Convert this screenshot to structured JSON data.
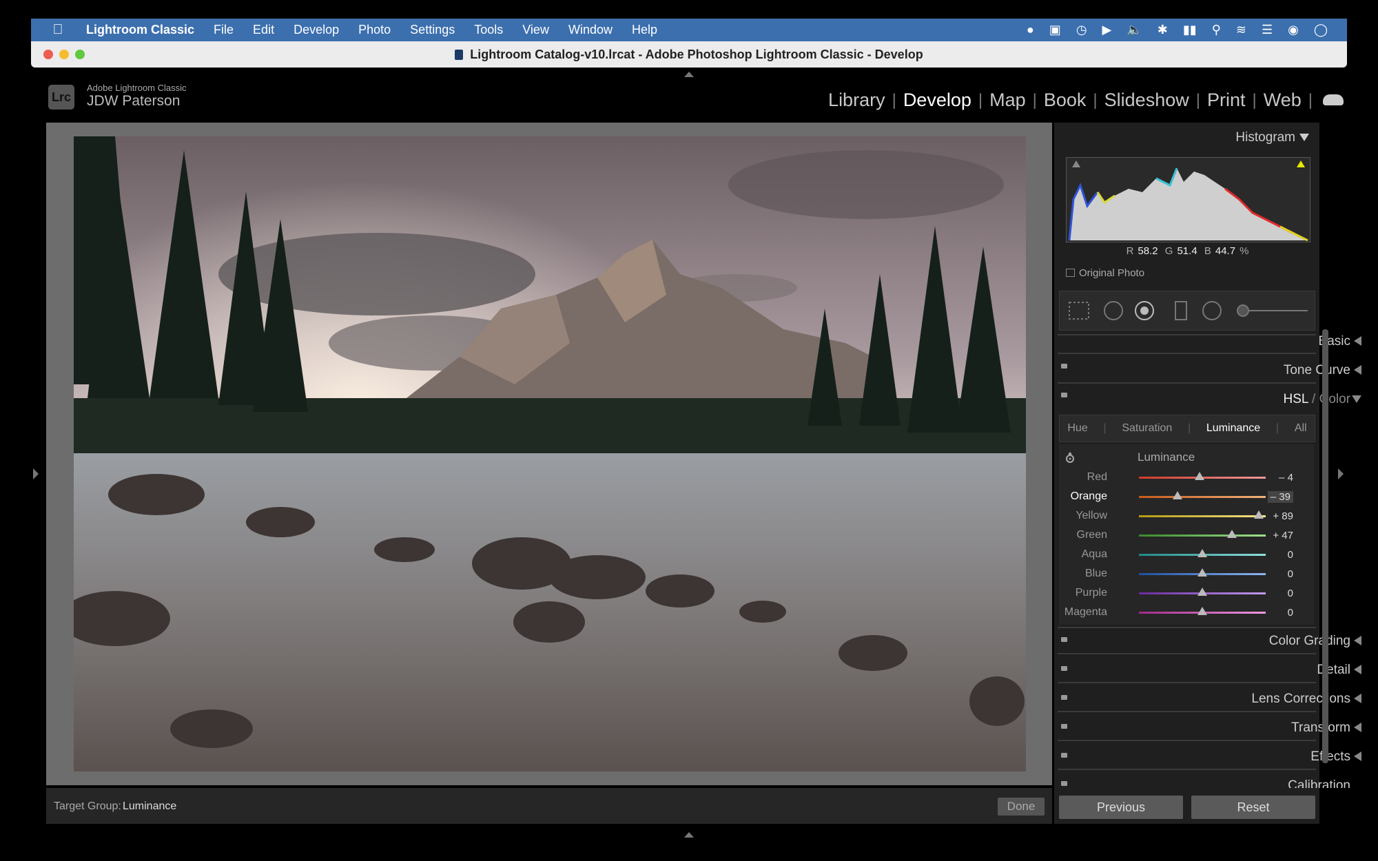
{
  "menubar": {
    "app_name": "Lightroom Classic",
    "items": [
      "File",
      "Edit",
      "Develop",
      "Photo",
      "Settings",
      "Tools",
      "View",
      "Window",
      "Help"
    ]
  },
  "window": {
    "title": "Lightroom Catalog-v10.lrcat - Adobe Photoshop Lightroom Classic - Develop"
  },
  "identity": {
    "logo": "Lrc",
    "brand": "Adobe Lightroom Classic",
    "user": "JDW Paterson"
  },
  "modules": [
    "Library",
    "Develop",
    "Map",
    "Book",
    "Slideshow",
    "Print",
    "Web"
  ],
  "active_module": "Develop",
  "toolbar": {
    "target_group_label": "Target Group:",
    "target_group_value": "Luminance",
    "done_label": "Done"
  },
  "panel": {
    "histogram_title": "Histogram",
    "readout": {
      "r_label": "R",
      "r": "58.2",
      "g_label": "G",
      "g": "51.4",
      "b_label": "B",
      "b": "44.7",
      "unit": "%"
    },
    "original_photo_label": "Original Photo",
    "sections": {
      "basic": "Basic",
      "tone_curve": "Tone Curve",
      "hsl": "HSL",
      "color": "Color",
      "color_sep": " / ",
      "color_grading": "Color Grading",
      "detail": "Detail",
      "lens_corrections": "Lens Corrections",
      "transform": "Transform",
      "effects": "Effects",
      "calibration": "Calibration"
    },
    "hsl_tabs": [
      "Hue",
      "Saturation",
      "Luminance",
      "All"
    ],
    "hsl_active_tab": "Luminance",
    "luminance_title": "Luminance",
    "sliders": [
      {
        "label": "Red",
        "value": "– 4",
        "num": -4,
        "colors": [
          "#d23a2a",
          "#e99"
        ]
      },
      {
        "label": "Orange",
        "value": "– 39",
        "num": -39,
        "colors": [
          "#c85a1c",
          "#f0b27a"
        ]
      },
      {
        "label": "Yellow",
        "value": "+ 89",
        "num": 89,
        "colors": [
          "#b59b12",
          "#f5e38a"
        ]
      },
      {
        "label": "Green",
        "value": "+ 47",
        "num": 47,
        "colors": [
          "#3a8a2a",
          "#9fe08f"
        ]
      },
      {
        "label": "Aqua",
        "value": "0",
        "num": 0,
        "colors": [
          "#1f8a88",
          "#8fe0de"
        ]
      },
      {
        "label": "Blue",
        "value": "0",
        "num": 0,
        "colors": [
          "#1f4fa0",
          "#8fb6ef"
        ]
      },
      {
        "label": "Purple",
        "value": "0",
        "num": 0,
        "colors": [
          "#6a2aa0",
          "#c39aef"
        ]
      },
      {
        "label": "Magenta",
        "value": "0",
        "num": 0,
        "colors": [
          "#a02a8a",
          "#ef9ae0"
        ]
      }
    ],
    "active_slider": "Orange",
    "previous_label": "Previous",
    "reset_label": "Reset"
  }
}
